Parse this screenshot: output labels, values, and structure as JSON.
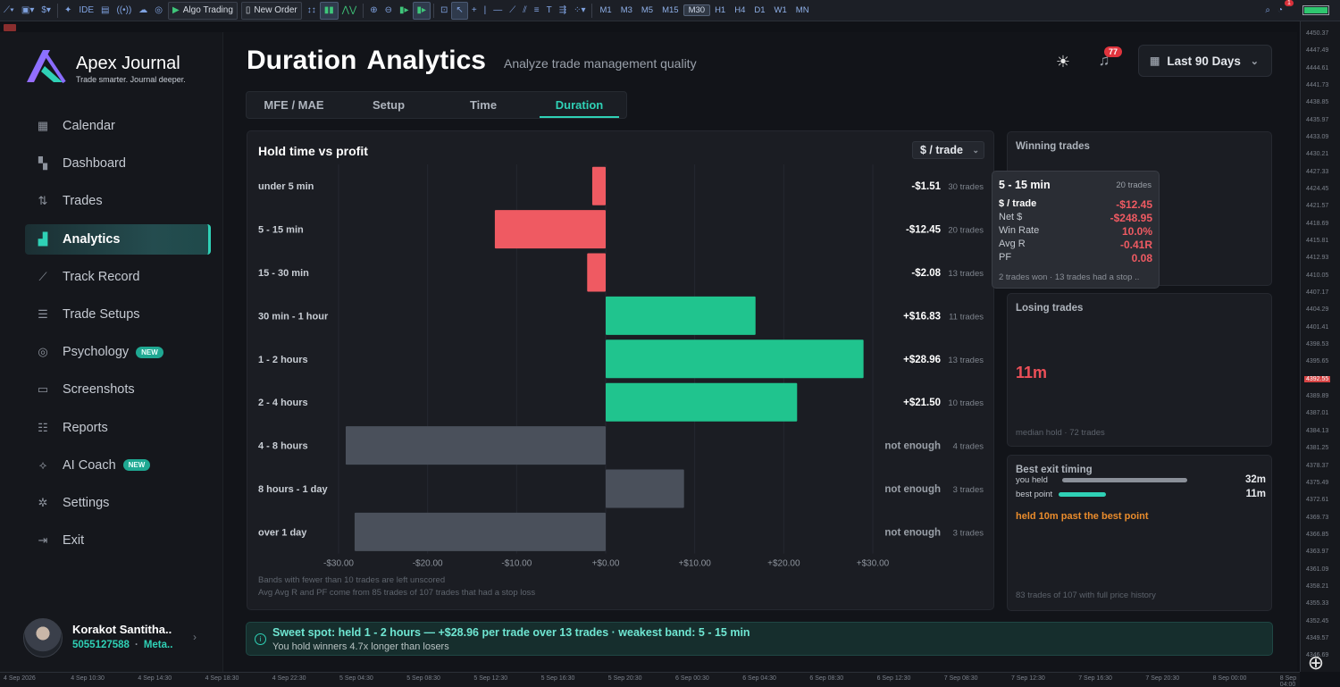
{
  "toolbar": {
    "algo_label": "Algo Trading",
    "order_label": "New Order",
    "ide_label": "IDE",
    "timeframes": [
      "M1",
      "M3",
      "M5",
      "M15",
      "M30",
      "H1",
      "H4",
      "D1",
      "W1",
      "MN"
    ],
    "active_timeframe": "M30",
    "notification_count": "1"
  },
  "price_axis": [
    "4450.37",
    "4447.49",
    "4444.61",
    "4441.73",
    "4438.85",
    "4435.97",
    "4433.09",
    "4430.21",
    "4427.33",
    "4424.45",
    "4421.57",
    "4418.69",
    "4415.81",
    "4412.93",
    "4410.05",
    "4407.17",
    "4404.29",
    "4401.41",
    "4398.53",
    "4395.65",
    "4392.55",
    "4389.89",
    "4387.01",
    "4384.13",
    "4381.25",
    "4378.37",
    "4375.49",
    "4372.61",
    "4369.73",
    "4366.85",
    "4363.97",
    "4361.09",
    "4358.21",
    "4355.33",
    "4352.45",
    "4349.57",
    "4346.69"
  ],
  "price_highlight": "4392.55",
  "time_axis": [
    "4 Sep 2026",
    "4 Sep 10:30",
    "4 Sep 14:30",
    "4 Sep 18:30",
    "4 Sep 22:30",
    "5 Sep 04:30",
    "5 Sep 08:30",
    "5 Sep 12:30",
    "5 Sep 16:30",
    "5 Sep 20:30",
    "6 Sep 00:30",
    "6 Sep 04:30",
    "6 Sep 08:30",
    "6 Sep 12:30",
    "7 Sep 08:30",
    "7 Sep 12:30",
    "7 Sep 16:30",
    "7 Sep 20:30",
    "8 Sep 00:00",
    "8 Sep 04:00",
    "8 Sep 08:00",
    "8 Sep 12:00",
    "8 Sep 16:00"
  ],
  "brand": {
    "name": "Apex Journal",
    "tagline": "Trade smarter. Journal deeper."
  },
  "nav": [
    {
      "label": "Calendar",
      "icon": "calendar-icon"
    },
    {
      "label": "Dashboard",
      "icon": "dashboard-icon"
    },
    {
      "label": "Trades",
      "icon": "trades-icon"
    },
    {
      "label": "Analytics",
      "icon": "analytics-icon",
      "active": true
    },
    {
      "label": "Track Record",
      "icon": "track-record-icon"
    },
    {
      "label": "Trade Setups",
      "icon": "sliders-icon"
    },
    {
      "label": "Psychology",
      "icon": "psychology-icon",
      "badge": "NEW"
    },
    {
      "label": "Screenshots",
      "icon": "screenshot-icon"
    },
    {
      "label": "Reports",
      "icon": "reports-icon"
    },
    {
      "label": "AI Coach",
      "icon": "ai-coach-icon",
      "badge": "NEW"
    },
    {
      "label": "Settings",
      "icon": "gear-icon"
    },
    {
      "label": "Exit",
      "icon": "exit-icon"
    }
  ],
  "user": {
    "name": "Korakot Santitha..",
    "account": "5055127588",
    "platform": "Meta.."
  },
  "header": {
    "title": "Duration  Analytics",
    "subtitle": "Analyze trade management quality",
    "notifications": "77",
    "date_range": "Last 90 Days"
  },
  "tabs": [
    "MFE / MAE",
    "Setup",
    "Time",
    "Duration"
  ],
  "active_tab": "Duration",
  "chart_card": {
    "title": "Hold time vs profit",
    "unit": "$ / trade",
    "notes": [
      "Bands with fewer than 10 trades are left unscored",
      "Avg Avg R and PF come from 85 trades of 107 trades that had a stop loss"
    ]
  },
  "chart_data": {
    "type": "bar",
    "orientation": "horizontal",
    "categories": [
      "under 5 min",
      "5 - 15 min",
      "15 - 30 min",
      "30 min - 1 hour",
      "1 - 2 hours",
      "2 - 4 hours",
      "4 - 8 hours",
      "8 hours - 1 day",
      "over 1 day"
    ],
    "values": [
      -1.51,
      -12.45,
      -2.08,
      16.83,
      28.96,
      21.5,
      -29.2,
      8.8,
      -28.2
    ],
    "scored": [
      true,
      true,
      true,
      true,
      true,
      true,
      false,
      false,
      false
    ],
    "value_labels": [
      "-$1.51",
      "-$12.45",
      "-$2.08",
      "+$16.83",
      "+$28.96",
      "+$21.50",
      "not enough",
      "not enough",
      "not enough"
    ],
    "trade_counts": [
      "30 trades",
      "20 trades",
      "13 trades",
      "11 trades",
      "13 trades",
      "10 trades",
      "4 trades",
      "3 trades",
      "3 trades"
    ],
    "xlim": [
      -30,
      30
    ],
    "x_ticks": [
      -30,
      -20,
      -10,
      0,
      10,
      20,
      30
    ],
    "x_tick_labels": [
      "-$30.00",
      "-$20.00",
      "-$10.00",
      "+$0.00",
      "+$10.00",
      "+$20.00",
      "+$30.00"
    ],
    "colors": {
      "positive": "#20c48e",
      "negative": "#ef5a62",
      "unscored": "#4a505b"
    },
    "grid": true
  },
  "winning_card": {
    "title": "Winning trades"
  },
  "tooltip": {
    "band": "5 - 15 min",
    "count": "20 trades",
    "rows": [
      {
        "label": "$ / trade",
        "value": "-$12.45"
      },
      {
        "label": "Net $",
        "value": "-$248.95"
      },
      {
        "label": "Win Rate",
        "value": "10.0%"
      },
      {
        "label": "Avg R",
        "value": "-0.41R"
      },
      {
        "label": "PF",
        "value": "0.08"
      }
    ],
    "footer": "2 trades won  ·  13 trades had a stop .."
  },
  "losing_card": {
    "title": "Losing trades",
    "value": "11m",
    "footer": "median hold  ·  72 trades"
  },
  "exit_card": {
    "title": "Best exit timing",
    "you_held_label": "you held",
    "you_held_value": "32m",
    "best_point_label": "best point",
    "best_point_value": "11m",
    "message": "held 10m past the best point",
    "footer": "83 trades of 107 with full price history"
  },
  "banner": {
    "headline": "Sweet spot: held 1 - 2 hours — +$28.96 per trade over 13 trades · weakest band: 5 - 15 min",
    "detail": "You hold winners 4.7x longer than losers"
  }
}
